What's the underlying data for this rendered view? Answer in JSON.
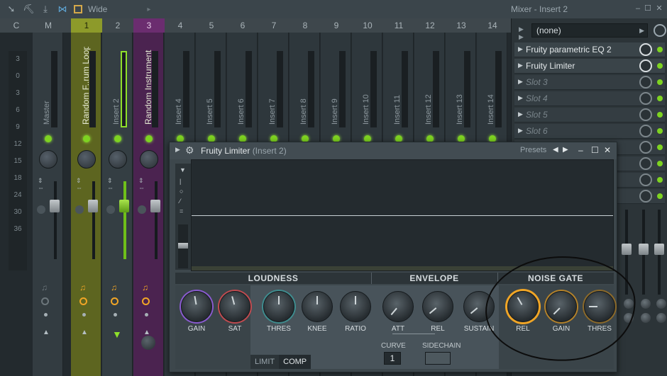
{
  "topbar": {
    "wide_label": "Wide",
    "title": "Mixer - Insert 2",
    "icons": [
      "arrow-icon",
      "pick-icon",
      "download-icon",
      "bowtie-icon",
      "box-icon"
    ]
  },
  "mixer": {
    "headers": [
      "C",
      "M",
      "1",
      "2",
      "3",
      "4",
      "5",
      "6",
      "7",
      "8",
      "9",
      "10",
      "11",
      "12",
      "13",
      "14"
    ],
    "scale": [
      "3",
      "0",
      "3",
      "6",
      "9",
      "12",
      "15",
      "18",
      "24",
      "30",
      "36"
    ],
    "strips": [
      {
        "label": "Master"
      },
      {
        "label": "Random F..rum Loop"
      },
      {
        "label": "Insert 2"
      },
      {
        "label": "Random Instrument"
      },
      {
        "label": "Insert 4"
      },
      {
        "label": "Insert 5"
      },
      {
        "label": "Insert 6"
      },
      {
        "label": "Insert 7"
      },
      {
        "label": "Insert 8"
      },
      {
        "label": "Insert 9"
      },
      {
        "label": "Insert 10"
      },
      {
        "label": "Insert 11"
      },
      {
        "label": "Insert 12"
      },
      {
        "label": "Insert 13"
      },
      {
        "label": "Insert 14"
      }
    ]
  },
  "right_panel": {
    "dropdown_value": "(none)",
    "slots": [
      {
        "name": "Fruity parametric EQ 2"
      },
      {
        "name": "Fruity Limiter"
      },
      {
        "name": "Slot 3"
      },
      {
        "name": "Slot 4"
      },
      {
        "name": "Slot 5"
      },
      {
        "name": "Slot 6"
      }
    ]
  },
  "plugin": {
    "title": "Fruity Limiter",
    "subtitle": "(Insert 2)",
    "presets_label": "Presets",
    "sections": {
      "loudness": "LOUDNESS",
      "envelope": "ENVELOPE",
      "noise_gate": "NOISE GATE"
    },
    "knobs": {
      "gain": "GAIN",
      "sat": "SAT",
      "thres": "THRES",
      "knee": "KNEE",
      "ratio": "RATIO",
      "att": "ATT",
      "rel": "REL",
      "sustain": "SUSTAIN",
      "ng_rel": "REL",
      "ng_gain": "GAIN",
      "ng_thres": "THRES"
    },
    "curve_label": "CURVE",
    "curve_value": "1",
    "sidechain_label": "SIDECHAIN",
    "modes": {
      "limit": "LIMIT",
      "comp": "COMP"
    }
  }
}
